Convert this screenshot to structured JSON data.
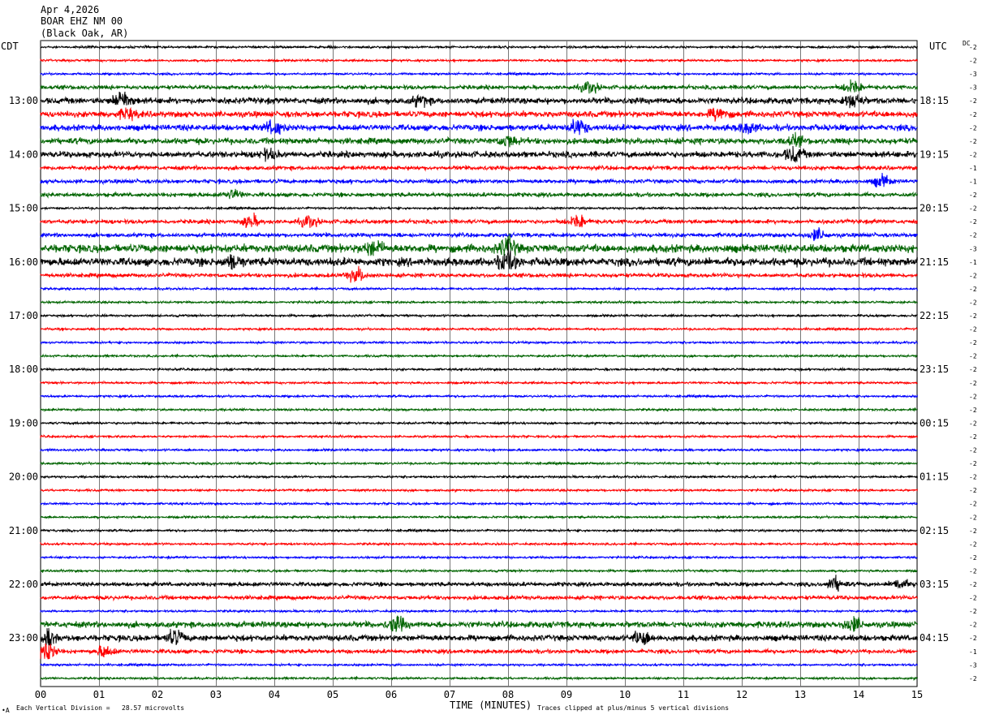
{
  "header": {
    "date": "Apr 4,2026",
    "station": "BOAR EHZ NM 00",
    "location": "(Black Oak, AR)"
  },
  "left_zone": "CDT",
  "right_zone": "UTC",
  "dc_label": "DC",
  "footer": {
    "scale_note": "Each Vertical Division =   28.57 microvolts",
    "clip_note": "Traces clipped at plus/minus 5 vertical divisions",
    "corner_mark": "•A"
  },
  "chart_data": {
    "type": "line",
    "title": "",
    "xlabel": "TIME (MINUTES)",
    "ylabel": "",
    "xlim": [
      0,
      15
    ],
    "x_ticks": [
      "00",
      "01",
      "02",
      "03",
      "04",
      "05",
      "06",
      "07",
      "08",
      "09",
      "10",
      "11",
      "12",
      "13",
      "14",
      "15"
    ],
    "trace_count": 48,
    "trace_color_cycle": [
      "#000000",
      "#ff0000",
      "#0000ff",
      "#006400"
    ],
    "left_time_labels": [
      {
        "row": 4,
        "text": "13:00"
      },
      {
        "row": 8,
        "text": "14:00"
      },
      {
        "row": 12,
        "text": "15:00"
      },
      {
        "row": 16,
        "text": "16:00"
      },
      {
        "row": 20,
        "text": "17:00"
      },
      {
        "row": 24,
        "text": "18:00"
      },
      {
        "row": 28,
        "text": "19:00"
      },
      {
        "row": 32,
        "text": "20:00"
      },
      {
        "row": 36,
        "text": "21:00"
      },
      {
        "row": 40,
        "text": "22:00"
      },
      {
        "row": 44,
        "text": "23:00"
      }
    ],
    "right_time_labels": [
      {
        "row": 4,
        "text": "18:15"
      },
      {
        "row": 8,
        "text": "19:15"
      },
      {
        "row": 12,
        "text": "20:15"
      },
      {
        "row": 16,
        "text": "21:15"
      },
      {
        "row": 20,
        "text": "22:15"
      },
      {
        "row": 24,
        "text": "23:15"
      },
      {
        "row": 28,
        "text": "00:15"
      },
      {
        "row": 32,
        "text": "01:15"
      },
      {
        "row": 36,
        "text": "02:15"
      },
      {
        "row": 40,
        "text": "03:15"
      },
      {
        "row": 44,
        "text": "04:15"
      }
    ],
    "dc_offsets": [
      "-2",
      "-2",
      "-3",
      "-3",
      "-2",
      "-2",
      "-2",
      "-2",
      "-2",
      "-1",
      "-1",
      "-2",
      "-2",
      "-2",
      "-2",
      "-3",
      "-1",
      "-2",
      "-2",
      "-2",
      "-2",
      "-2",
      "-2",
      "-2",
      "-2",
      "-2",
      "-2",
      "-2",
      "-2",
      "-2",
      "-2",
      "-2",
      "-2",
      "-2",
      "-2",
      "-2",
      "-2",
      "-2",
      "-2",
      "-2",
      "-2",
      "-2",
      "-2",
      "-2",
      "-2",
      "-1",
      "-3",
      "-2"
    ],
    "trace_activity": [
      1,
      1,
      1,
      2,
      3,
      3,
      3,
      3,
      3,
      2,
      2,
      2,
      1,
      2,
      2,
      4,
      4,
      2,
      1,
      1,
      1,
      1,
      1,
      1,
      1,
      1,
      1,
      1,
      1,
      1,
      1,
      1,
      1,
      1,
      1,
      1,
      1,
      1,
      1,
      1,
      2,
      2,
      1,
      3,
      3,
      2,
      1,
      1
    ],
    "bursts": [
      {
        "row": 3,
        "x": 9.4,
        "amp": 5
      },
      {
        "row": 3,
        "x": 13.9,
        "amp": 6
      },
      {
        "row": 4,
        "x": 1.4,
        "amp": 8
      },
      {
        "row": 4,
        "x": 13.9,
        "amp": 7
      },
      {
        "row": 4,
        "x": 6.5,
        "amp": 4
      },
      {
        "row": 5,
        "x": 1.5,
        "amp": 4
      },
      {
        "row": 5,
        "x": 11.6,
        "amp": 6
      },
      {
        "row": 6,
        "x": 4.0,
        "amp": 6
      },
      {
        "row": 6,
        "x": 9.2,
        "amp": 7
      },
      {
        "row": 6,
        "x": 12.1,
        "amp": 5
      },
      {
        "row": 7,
        "x": 8.0,
        "amp": 5
      },
      {
        "row": 7,
        "x": 12.9,
        "amp": 4
      },
      {
        "row": 8,
        "x": 12.9,
        "amp": 7
      },
      {
        "row": 8,
        "x": 3.9,
        "amp": 4
      },
      {
        "row": 10,
        "x": 14.4,
        "amp": 5
      },
      {
        "row": 11,
        "x": 3.3,
        "amp": 4
      },
      {
        "row": 13,
        "x": 3.6,
        "amp": 5
      },
      {
        "row": 13,
        "x": 4.6,
        "amp": 5
      },
      {
        "row": 13,
        "x": 9.2,
        "amp": 6
      },
      {
        "row": 14,
        "x": 13.3,
        "amp": 5
      },
      {
        "row": 15,
        "x": 5.7,
        "amp": 7
      },
      {
        "row": 15,
        "x": 8.0,
        "amp": 9
      },
      {
        "row": 16,
        "x": 8.0,
        "amp": 12
      },
      {
        "row": 16,
        "x": 3.3,
        "amp": 5
      },
      {
        "row": 17,
        "x": 5.4,
        "amp": 6
      },
      {
        "row": 40,
        "x": 13.6,
        "amp": 6
      },
      {
        "row": 40,
        "x": 14.7,
        "amp": 5
      },
      {
        "row": 43,
        "x": 6.1,
        "amp": 6
      },
      {
        "row": 43,
        "x": 13.9,
        "amp": 6
      },
      {
        "row": 44,
        "x": 0.1,
        "amp": 8
      },
      {
        "row": 44,
        "x": 2.3,
        "amp": 6
      },
      {
        "row": 44,
        "x": 10.3,
        "amp": 6
      },
      {
        "row": 45,
        "x": 0.1,
        "amp": 9
      },
      {
        "row": 45,
        "x": 1.1,
        "amp": 5
      }
    ]
  }
}
